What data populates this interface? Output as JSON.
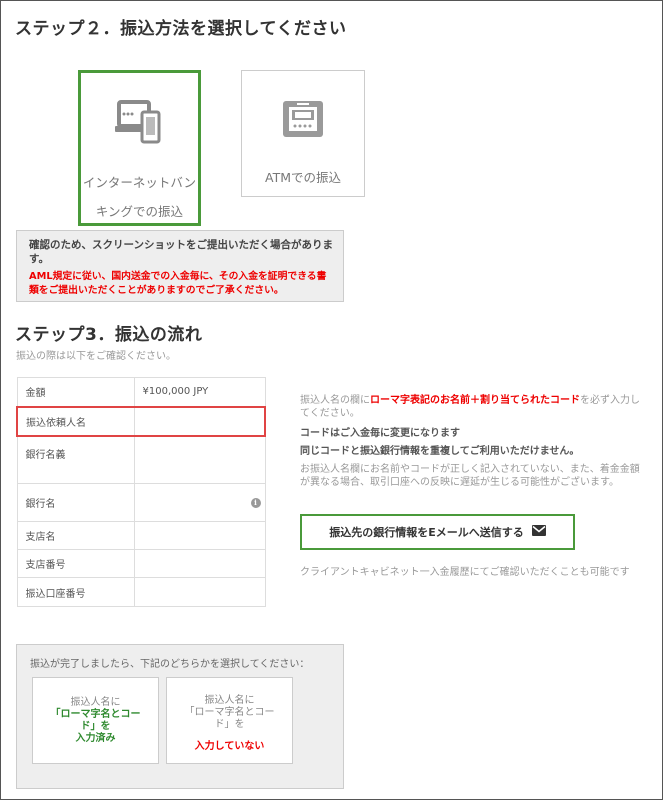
{
  "step2": {
    "title": "ステップ２．振込方法を選択してください",
    "methods": [
      {
        "label": "インターネットバンキングでの振込",
        "icon": "devices-icon",
        "selected": true
      },
      {
        "label": "ATMでの振込",
        "icon": "atm-icon",
        "selected": false
      }
    ],
    "notice": {
      "main": "確認のため、スクリーンショットをご提出いただく場合があります。",
      "red": "AML規定に従い、国内送金での入金毎に、その入金を証明できる書類をご提出いただくことがありますのでご了承ください。"
    }
  },
  "step3": {
    "title": "ステップ3．振込の流れ",
    "subtitle": "振込の際は以下をご確認ください。",
    "table": [
      {
        "label": "金額",
        "value": "¥100,000 JPY"
      },
      {
        "label": "振込依頼人名",
        "value": ""
      },
      {
        "label": "銀行名義",
        "value": ""
      },
      {
        "label": "銀行名",
        "value": ""
      },
      {
        "label": "支店名",
        "value": ""
      },
      {
        "label": "支店番号",
        "value": ""
      },
      {
        "label": "振込口座番号",
        "value": ""
      }
    ],
    "instructions": {
      "line1_pre": "振込人名の欄に",
      "line1_red": "ローマ字表記のお名前＋割り当てられたコード",
      "line1_post": "を必ず入力してください。",
      "line2": "コードはご入金毎に変更になります",
      "line3": "同じコードと振込銀行情報を重複してご利用いただけません。",
      "line4": "お振込人名欄にお名前やコードが正しく記入されていない、また、着金金額が異なる場合、取引口座への反映に遅延が生じる可能性がございます。"
    },
    "email_button": "振込先の銀行情報をEメールへ送信する",
    "cabinet_note": "クライアントキャビネット一入金履歴にてご確認いただくことも可能です"
  },
  "completion": {
    "prompt": "振込が完了しましたら、下記のどちらかを選択してください：",
    "choice_yes": {
      "l1": "振込人名に",
      "l2": "「ローマ字名とコー",
      "l3": "ド」を",
      "l4": "入力済み"
    },
    "choice_no": {
      "l1": "振込人名に",
      "l2": "「ローマ字名とコー",
      "l3": "ド」を",
      "l4": "入力していない"
    }
  },
  "colors": {
    "accent_green": "#4a9a3a",
    "alert_red": "#e00000",
    "highlight_red": "#e04444"
  }
}
